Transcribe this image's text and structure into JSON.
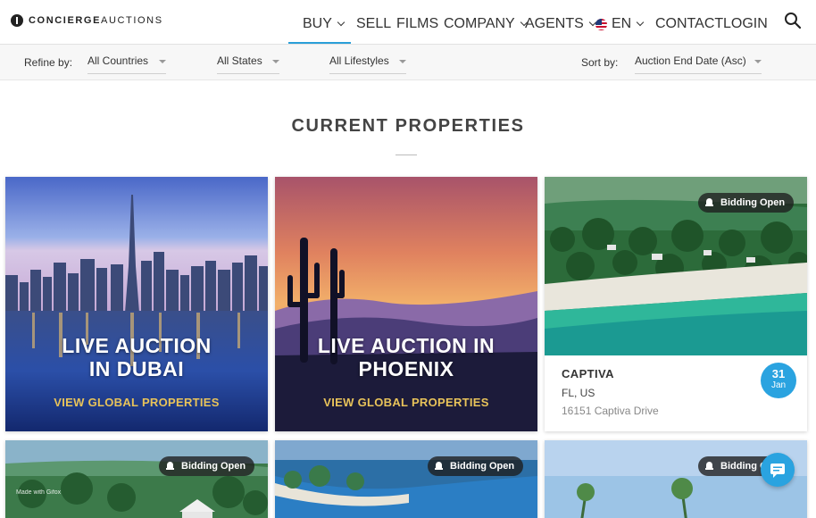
{
  "header": {
    "logo_bold": "CONCIERGE",
    "logo_light": "AUCTIONS",
    "nav": [
      {
        "label": "BUY",
        "dropdown": true,
        "active": true
      },
      {
        "label": "SELL",
        "dropdown": false
      },
      {
        "label": "FILMS",
        "dropdown": false
      },
      {
        "label": "COMPANY",
        "dropdown": true
      },
      {
        "label": "AGENTS",
        "dropdown": true
      },
      {
        "label": "EN",
        "dropdown": true,
        "icon": "us-flag-icon"
      },
      {
        "label": "CONTACT",
        "dropdown": false
      },
      {
        "label": "LOGIN",
        "dropdown": false
      }
    ],
    "search_icon": "search-icon",
    "accent": "#2a9fd8"
  },
  "filters": {
    "refine_label": "Refine by:",
    "country": "All Countries",
    "state": "All States",
    "lifestyle": "All Lifestyles",
    "sort_label": "Sort by:",
    "sort_value": "Auction End Date (Asc)"
  },
  "section": {
    "title": "CURRENT PROPERTIES"
  },
  "cards": [
    {
      "type": "promo",
      "headline": "LIVE AUCTION\nIN DUBAI",
      "link": "VIEW GLOBAL PROPERTIES"
    },
    {
      "type": "promo",
      "headline": "LIVE AUCTION IN\nPHOENIX",
      "link": "VIEW GLOBAL PROPERTIES"
    },
    {
      "type": "property",
      "badge": "Bidding Open",
      "city": "CAPTIVA",
      "state": "FL, US",
      "address": "16151 Captiva Drive",
      "day": "31",
      "month": "Jan"
    },
    {
      "type": "property",
      "badge": "Bidding Open"
    },
    {
      "type": "property",
      "badge": "Bidding Open"
    },
    {
      "type": "property",
      "badge": "Bidding Open"
    }
  ],
  "watermark": "Made with Gifox",
  "chat_icon": "chat-icon",
  "colors": {
    "date_badge": "#2aa3e0",
    "promo_link": "#e8c35a"
  }
}
